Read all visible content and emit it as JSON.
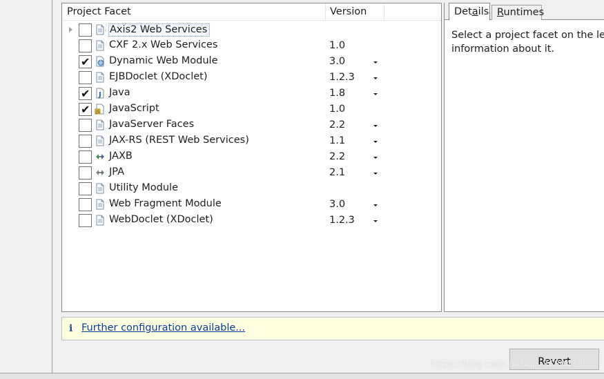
{
  "facets_table": {
    "col_facet": "Project Facet",
    "col_version": "Version",
    "rows": [
      {
        "name": "Axis2 Web Services",
        "version": "",
        "checked": false,
        "dropdown": false,
        "icon": "page-icon",
        "expandable": true,
        "selected": true
      },
      {
        "name": "CXF 2.x Web Services",
        "version": "1.0",
        "checked": false,
        "dropdown": false,
        "icon": "page-icon"
      },
      {
        "name": "Dynamic Web Module",
        "version": "3.0",
        "checked": true,
        "dropdown": true,
        "icon": "web-module-icon"
      },
      {
        "name": "EJBDoclet (XDoclet)",
        "version": "1.2.3",
        "checked": false,
        "dropdown": true,
        "icon": "page-icon"
      },
      {
        "name": "Java",
        "version": "1.8",
        "checked": true,
        "dropdown": true,
        "icon": "java-icon"
      },
      {
        "name": "JavaScript",
        "version": "1.0",
        "checked": true,
        "dropdown": false,
        "icon": "javascript-icon"
      },
      {
        "name": "JavaServer Faces",
        "version": "2.2",
        "checked": false,
        "dropdown": true,
        "icon": "page-icon"
      },
      {
        "name": "JAX-RS (REST Web Services)",
        "version": "1.1",
        "checked": false,
        "dropdown": true,
        "icon": "page-icon"
      },
      {
        "name": "JAXB",
        "version": "2.2",
        "checked": false,
        "dropdown": true,
        "icon": "jaxb-icon"
      },
      {
        "name": "JPA",
        "version": "2.1",
        "checked": false,
        "dropdown": true,
        "icon": "jpa-icon"
      },
      {
        "name": "Utility Module",
        "version": "",
        "checked": false,
        "dropdown": false,
        "icon": "page-icon"
      },
      {
        "name": "Web Fragment Module",
        "version": "3.0",
        "checked": false,
        "dropdown": true,
        "icon": "page-icon"
      },
      {
        "name": "WebDoclet (XDoclet)",
        "version": "1.2.3",
        "checked": false,
        "dropdown": true,
        "icon": "page-icon"
      }
    ]
  },
  "details_panel": {
    "tab_details_pre": "Det",
    "tab_details_mnemonic": "a",
    "tab_details_post": "ils",
    "tab_runtimes_mnemonic": "R",
    "tab_runtimes_post": "untimes",
    "text_line1": "Select a project facet on the le",
    "text_line2": "information about it."
  },
  "info_bar": {
    "icon": "info-icon",
    "link_text": "Further configuration available..."
  },
  "buttons": {
    "revert_label": "Revert"
  },
  "watermark": "https://blog.csdn.net/qq_36804380",
  "colors": {
    "info_background": "#ffffe1",
    "link": "#0b3e9a",
    "panel_border": "#828790"
  }
}
